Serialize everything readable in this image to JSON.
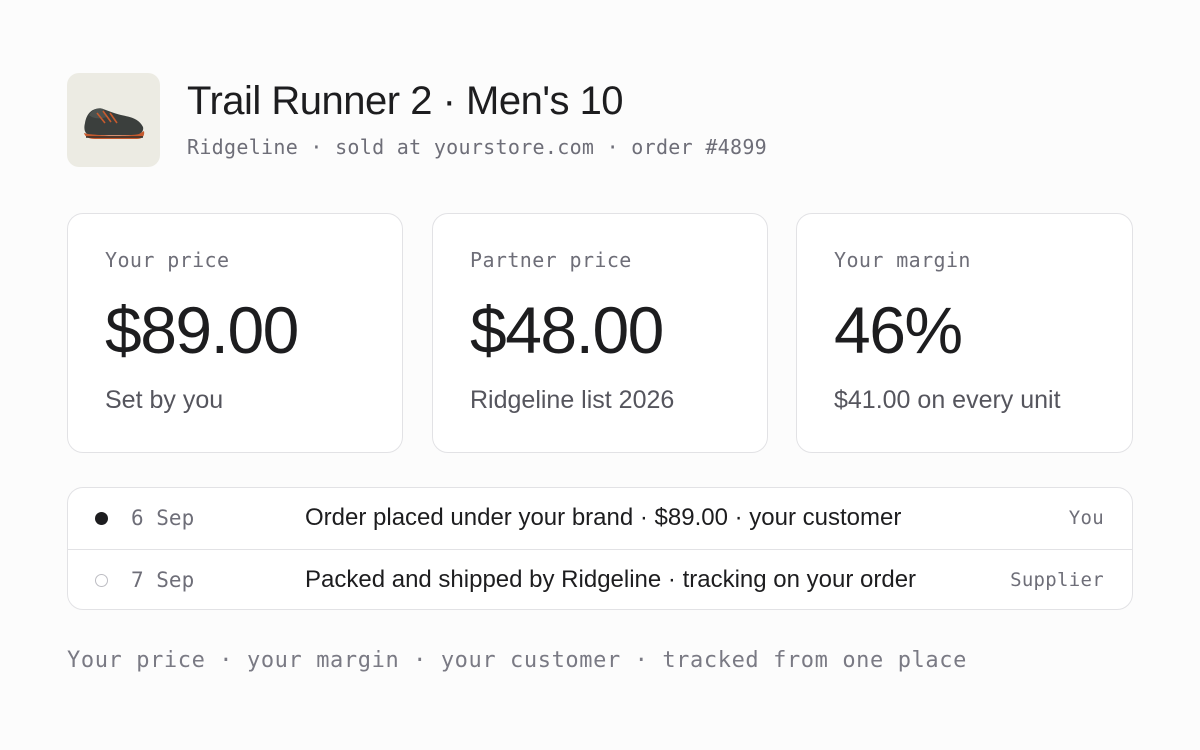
{
  "product": {
    "title": "Trail Runner 2 · Men's 10",
    "subtitle": "Ridgeline · sold at yourstore.com · order #4899",
    "image_icon": "trail-shoe-icon"
  },
  "cards": [
    {
      "label": "Your price",
      "value": "$89.00",
      "note": "Set by you"
    },
    {
      "label": "Partner price",
      "value": "$48.00",
      "note": "Ridgeline list 2026"
    },
    {
      "label": "Your margin",
      "value": "46%",
      "note": "$41.00 on every unit"
    }
  ],
  "timeline": [
    {
      "date": "6 Sep",
      "text": "Order placed under your brand · $89.00 · your customer",
      "actor": "You",
      "status": "done"
    },
    {
      "date": "7 Sep",
      "text": "Packed and shipped by Ridgeline · tracking on your order",
      "actor": "Supplier",
      "status": "pending"
    }
  ],
  "footer": "Your price · your margin · your customer · tracked from one place",
  "colors": {
    "background": "#fcfcfc",
    "card_border": "#e2e2e5",
    "text_primary": "#1d1d1f",
    "text_muted": "#6e6e78",
    "thumb_bg": "#ecebe3",
    "shoe_accent": "#c65a2e"
  }
}
